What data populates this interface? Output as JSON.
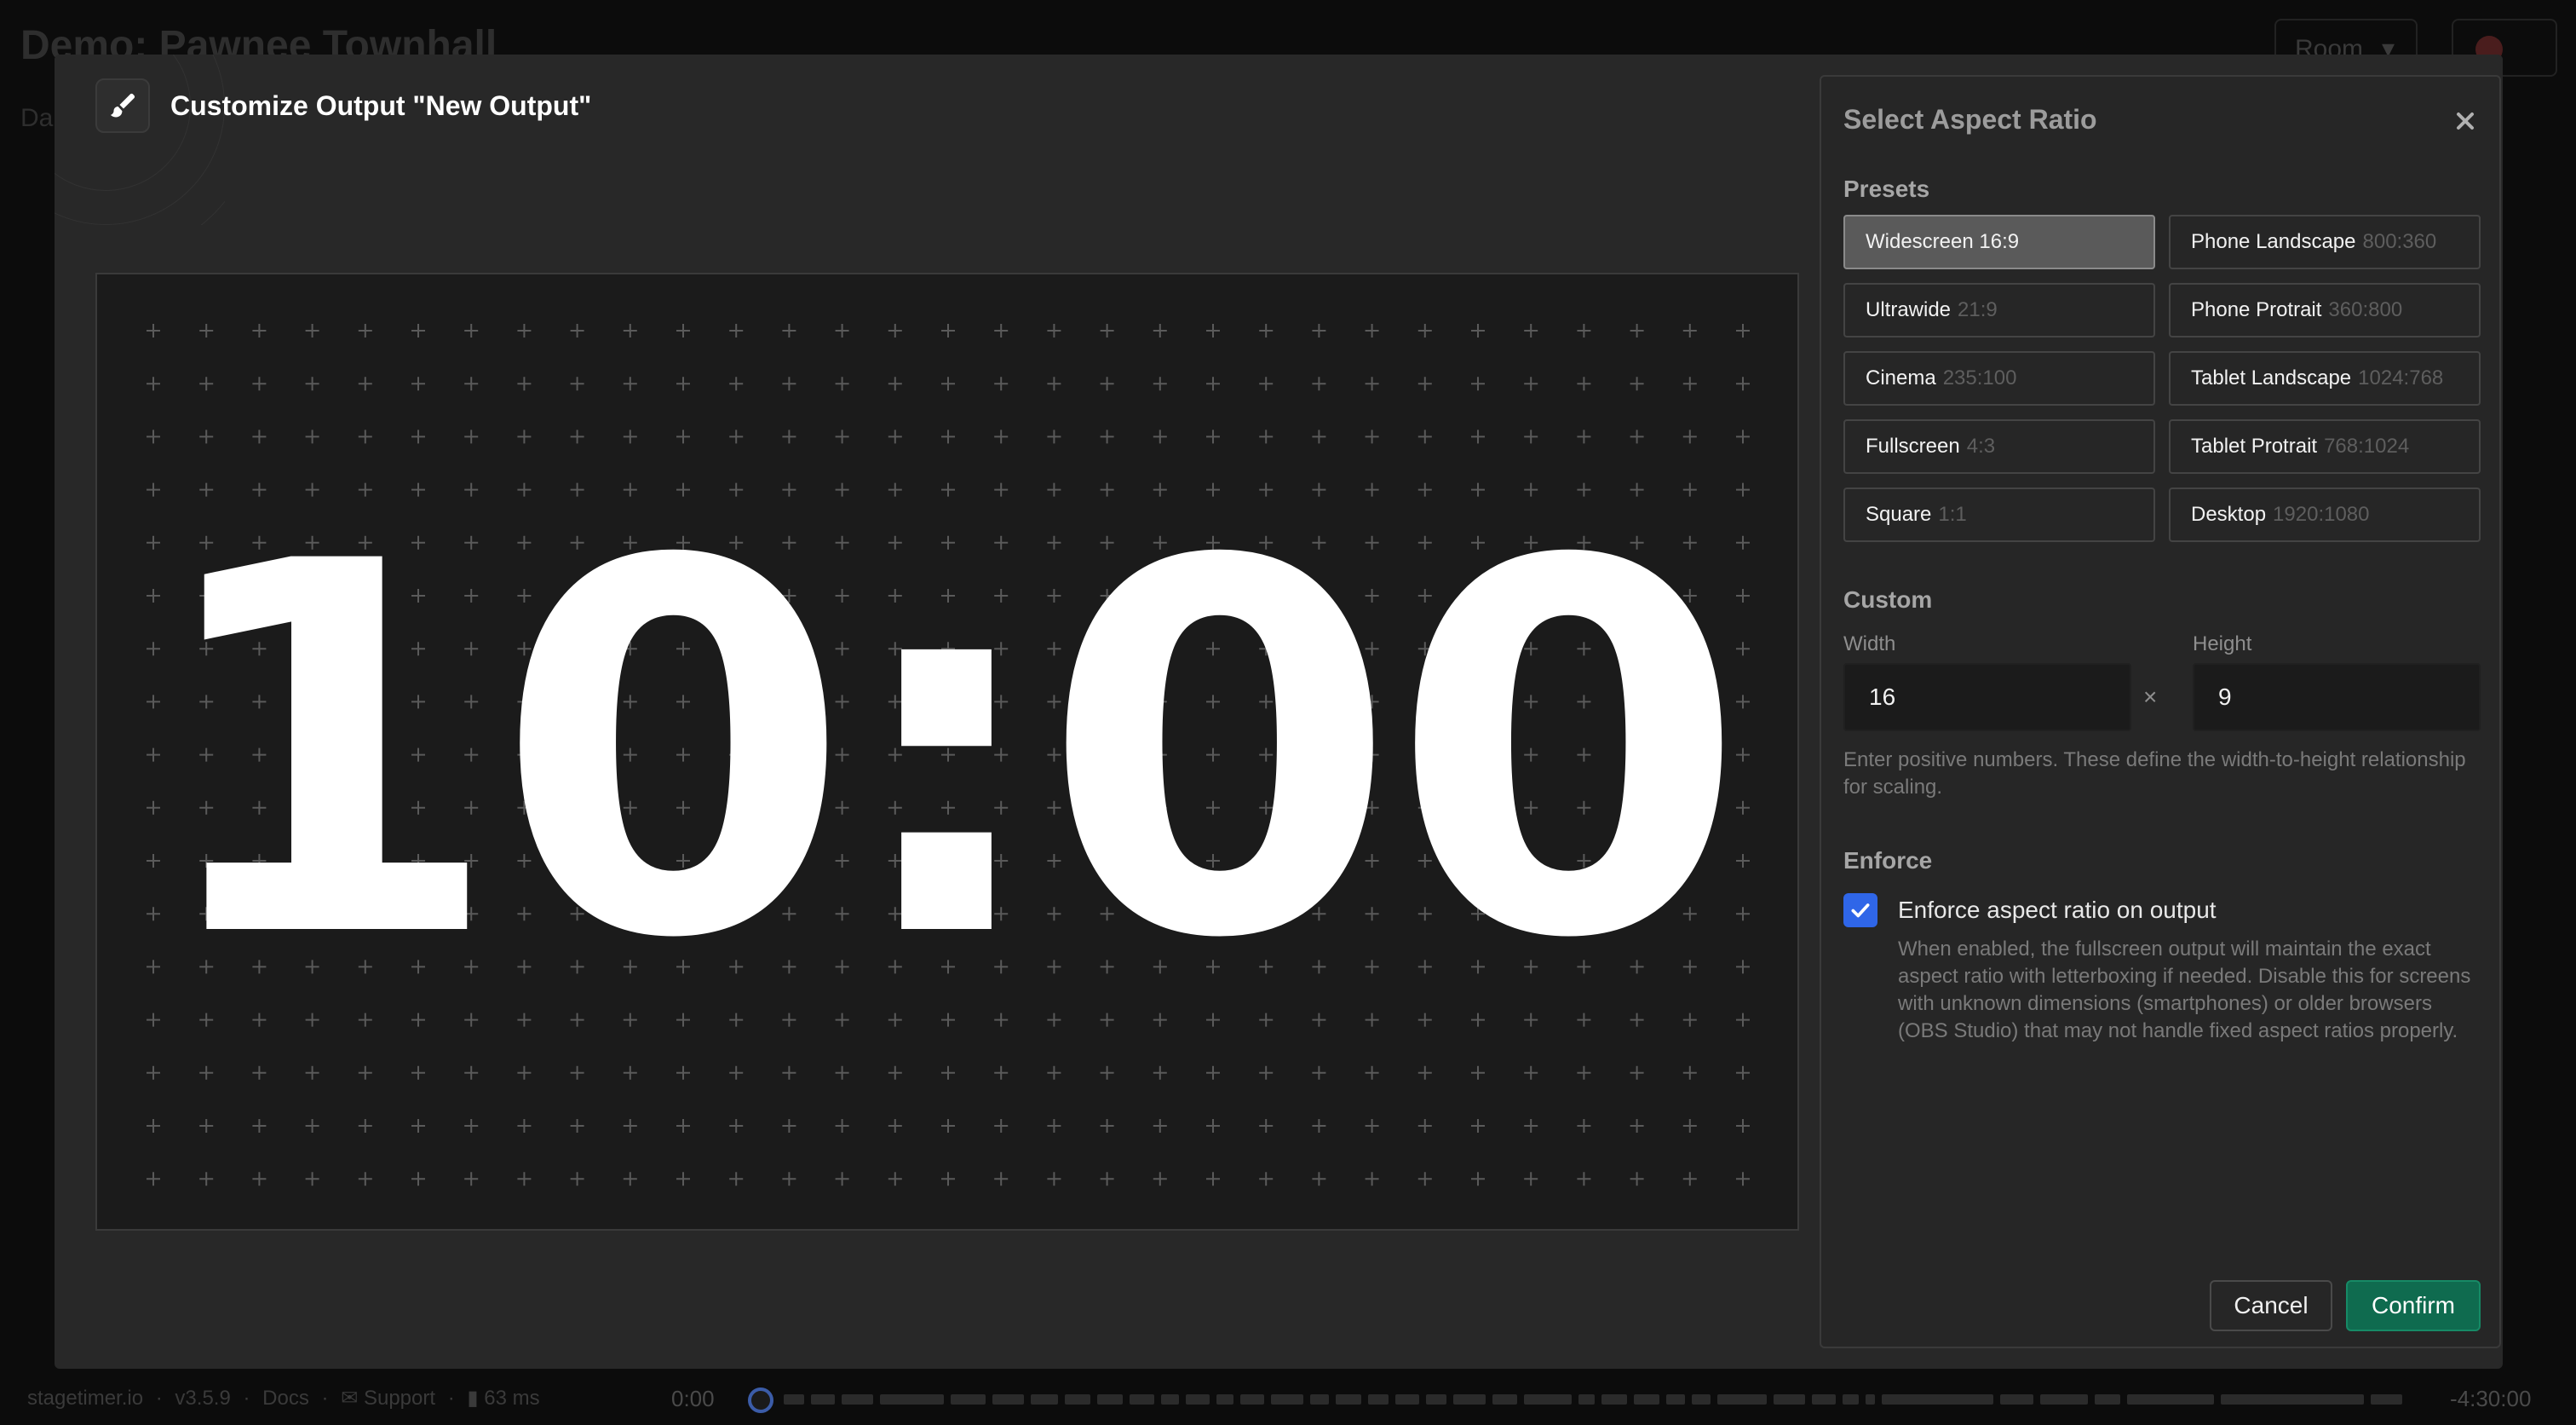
{
  "background": {
    "title": "Demo: Pawnee Townhall",
    "subtitle": "Da",
    "room_label": "Room",
    "footer": {
      "brand": "stagetimer.io",
      "version": "v3.5.9",
      "docs": "Docs",
      "support": "Support",
      "latency": "63 ms",
      "time_start": "0:00",
      "time_end": "-4:30:00"
    }
  },
  "modal": {
    "title": "Customize Output \"New Output\"",
    "preview_clock": "10:00"
  },
  "panel": {
    "title": "Select Aspect Ratio",
    "presets_heading": "Presets",
    "presets": [
      {
        "name": "Widescreen",
        "ratio": "16:9",
        "selected": true
      },
      {
        "name": "Phone Landscape",
        "ratio": "800:360",
        "selected": false
      },
      {
        "name": "Ultrawide",
        "ratio": "21:9",
        "selected": false
      },
      {
        "name": "Phone Protrait",
        "ratio": "360:800",
        "selected": false
      },
      {
        "name": "Cinema",
        "ratio": "235:100",
        "selected": false
      },
      {
        "name": "Tablet Landscape",
        "ratio": "1024:768",
        "selected": false
      },
      {
        "name": "Fullscreen",
        "ratio": "4:3",
        "selected": false
      },
      {
        "name": "Tablet Protrait",
        "ratio": "768:1024",
        "selected": false
      },
      {
        "name": "Square",
        "ratio": "1:1",
        "selected": false
      },
      {
        "name": "Desktop",
        "ratio": "1920:1080",
        "selected": false
      }
    ],
    "custom_heading": "Custom",
    "width_label": "Width",
    "width_value": "16",
    "height_label": "Height",
    "height_value": "9",
    "times_symbol": "×",
    "custom_help": "Enter positive numbers. These define the width-to-height relationship for scaling.",
    "enforce_heading": "Enforce",
    "enforce_checked": true,
    "enforce_label": "Enforce aspect ratio on output",
    "enforce_desc": "When enabled, the fullscreen output will maintain the exact aspect ratio with letterboxing if needed. Disable this for screens with unknown dimensions (smartphones) or older browsers (OBS Studio) that may not handle fixed aspect ratios properly.",
    "cancel_label": "Cancel",
    "confirm_label": "Confirm"
  },
  "colors": {
    "accent_confirm": "#0f6b4f",
    "checkbox": "#2f66e8",
    "modal_bg": "#282828",
    "preview_bg": "#1b1b1b"
  }
}
